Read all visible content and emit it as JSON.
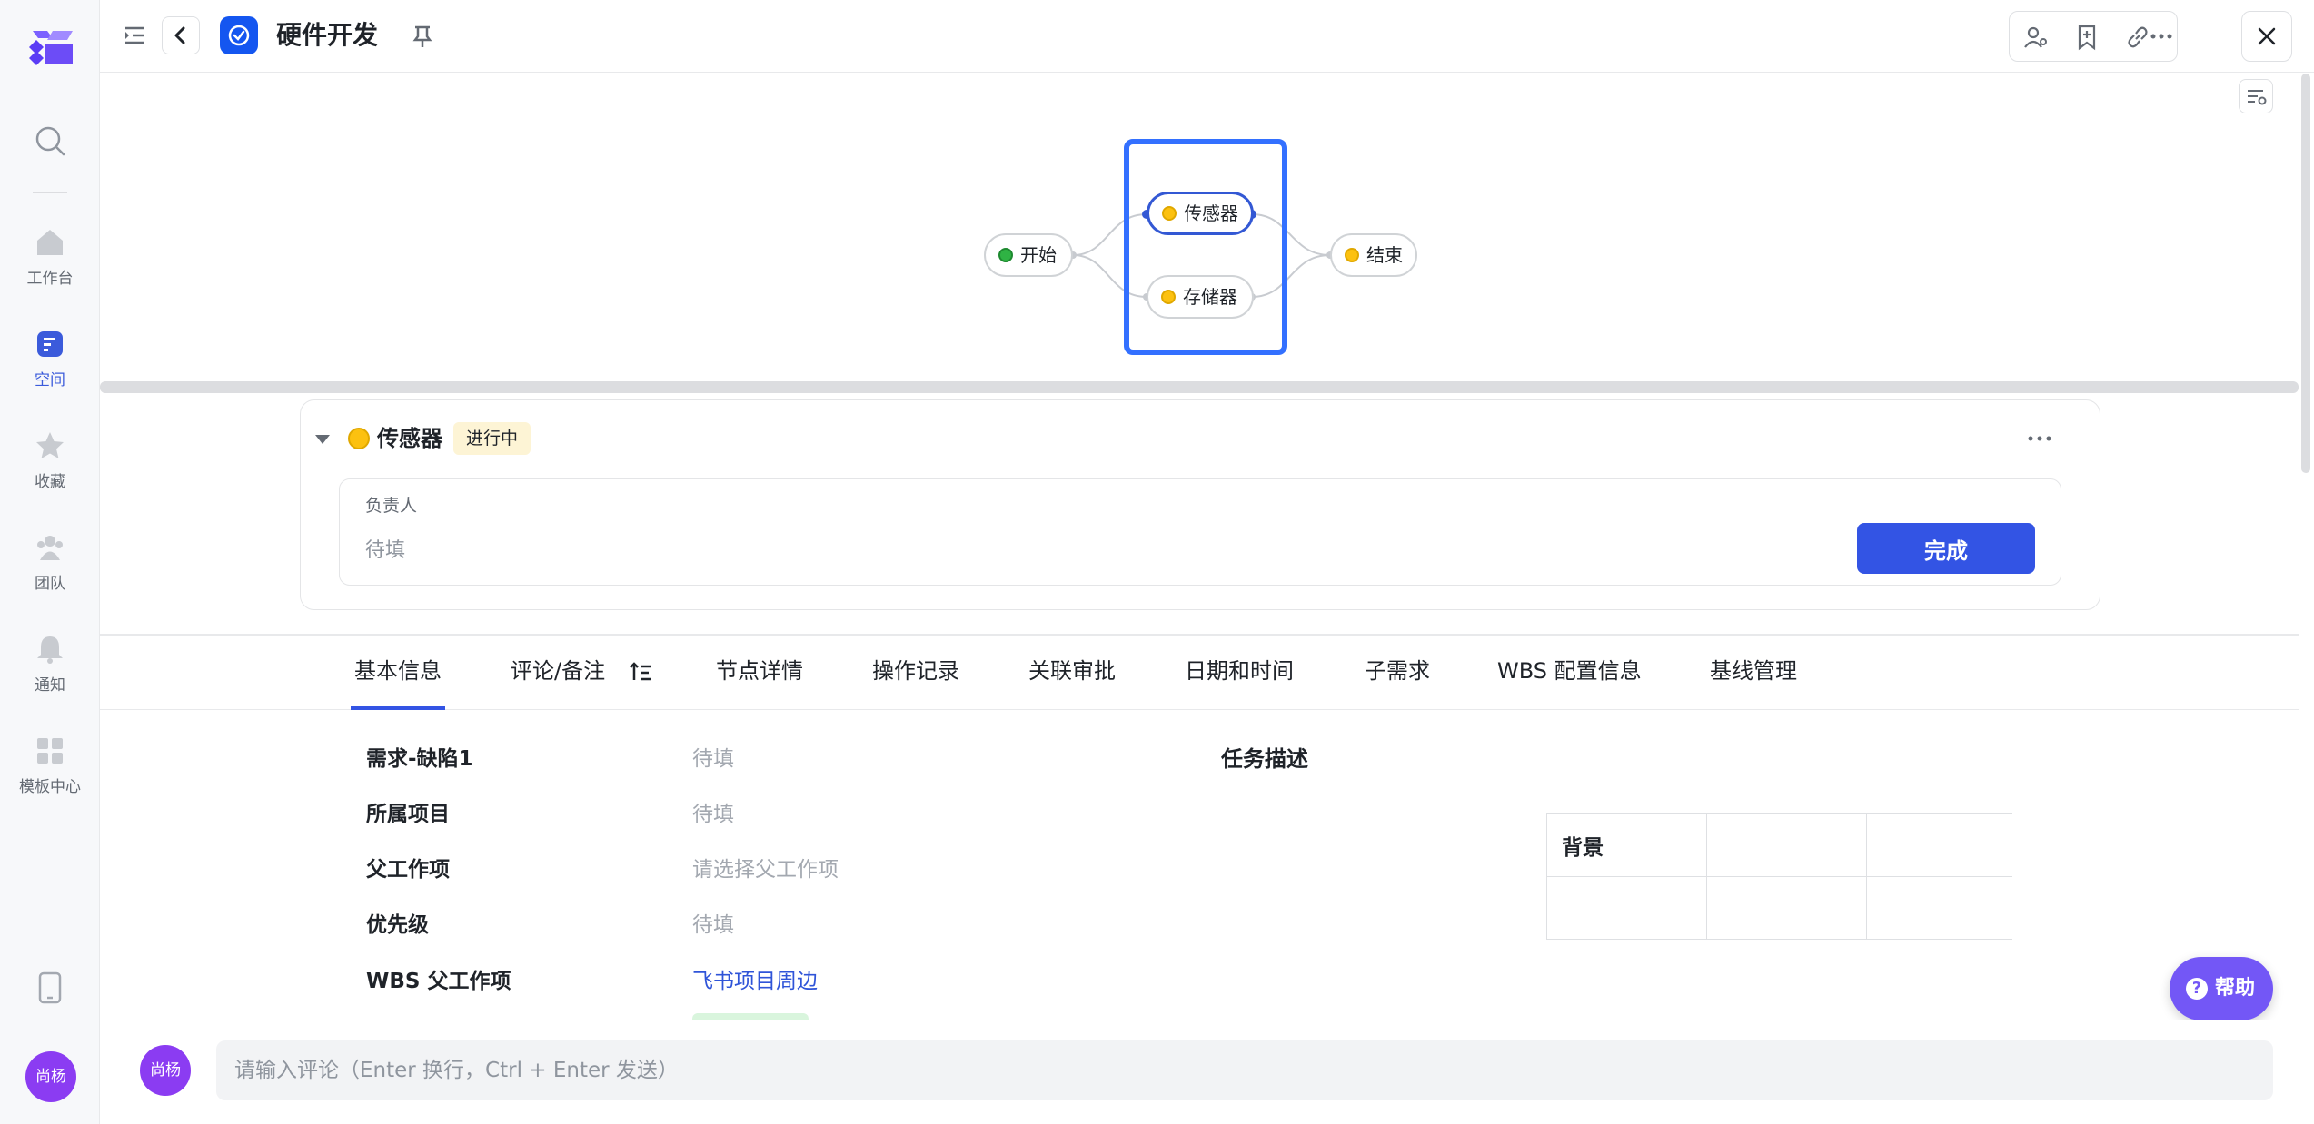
{
  "nav": {
    "items": [
      {
        "label": "工作台",
        "icon": "home-icon"
      },
      {
        "label": "空间",
        "icon": "space-icon"
      },
      {
        "label": "收藏",
        "icon": "star-icon"
      },
      {
        "label": "团队",
        "icon": "team-icon"
      },
      {
        "label": "通知",
        "icon": "bell-icon"
      },
      {
        "label": "模板中心",
        "icon": "template-icon"
      }
    ],
    "active": "空间",
    "user_avatar": "尚杨"
  },
  "header": {
    "title": "硬件开发"
  },
  "flow": {
    "nodes": [
      {
        "id": "start",
        "label": "开始",
        "status_color": "#2fb344"
      },
      {
        "id": "sensor",
        "label": "传感器",
        "status_color": "#fcc110",
        "selected": true
      },
      {
        "id": "storage",
        "label": "存储器",
        "status_color": "#fcc110"
      },
      {
        "id": "end",
        "label": "结束",
        "status_color": "#fcc110"
      }
    ],
    "accent": "#3370ff"
  },
  "node_card": {
    "name": "传感器",
    "status": "进行中",
    "owner_label": "负责人",
    "owner_value": "待填",
    "done_label": "完成"
  },
  "tabs": [
    {
      "label": "基本信息",
      "active": true
    },
    {
      "label": "评论/备注"
    },
    {
      "label": "节点详情"
    },
    {
      "label": "操作记录"
    },
    {
      "label": "关联审批"
    },
    {
      "label": "日期和时间"
    },
    {
      "label": "子需求"
    },
    {
      "label": "WBS 配置信息"
    },
    {
      "label": "基线管理"
    }
  ],
  "fields": [
    {
      "label": "需求-缺陷1",
      "value": "待填"
    },
    {
      "label": "所属项目",
      "value": "待填"
    },
    {
      "label": "父工作项",
      "value": "请选择父工作项"
    },
    {
      "label": "优先级",
      "value": "待填"
    },
    {
      "label": "WBS 父工作项",
      "value": "飞书项目周边",
      "link": true
    }
  ],
  "description": {
    "label": "任务描述",
    "table_header": "背景"
  },
  "help_label": "帮助",
  "comment": {
    "avatar": "尚杨",
    "placeholder": "请输入评论（Enter 换行，Ctrl + Enter 发送）"
  }
}
